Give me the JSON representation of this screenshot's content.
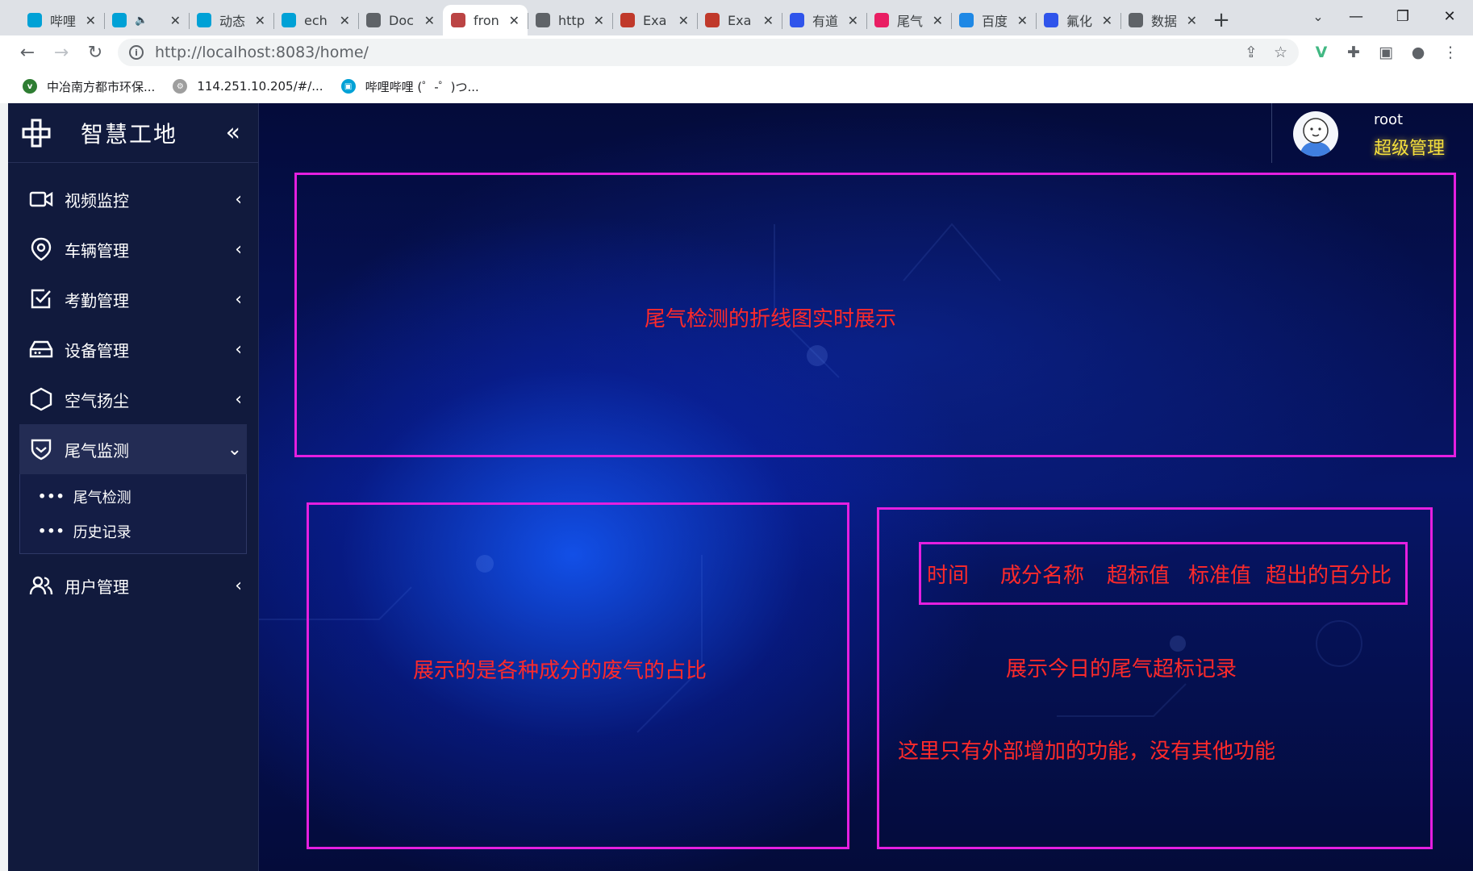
{
  "browser": {
    "tabs": [
      {
        "title": "哔哩",
        "favicon_color": "#00a1d6",
        "favicon": "tv-icon"
      },
      {
        "title": "",
        "favicon_color": "#00a1d6",
        "favicon": "tv-icon",
        "audio": "🔈"
      },
      {
        "title": "动态",
        "favicon_color": "#00a1d6",
        "favicon": "tv-icon"
      },
      {
        "title": "ech",
        "favicon_color": "#00a1d6",
        "favicon": "tv-icon"
      },
      {
        "title": "Doc",
        "favicon_color": "#5f6368",
        "favicon": "globe-icon"
      },
      {
        "title": "fron",
        "favicon_color": "#b44",
        "favicon": "app-icon",
        "active": true
      },
      {
        "title": "http",
        "favicon_color": "#5f6368",
        "favicon": "globe-icon"
      },
      {
        "title": "Exa",
        "favicon_color": "#c0392b",
        "favicon": "q-icon"
      },
      {
        "title": "Exa",
        "favicon_color": "#c0392b",
        "favicon": "q-icon"
      },
      {
        "title": "有道",
        "favicon_color": "#2f54eb",
        "favicon": "paw-icon"
      },
      {
        "title": "尾气",
        "favicon_color": "#e91e63",
        "favicon": "y-icon"
      },
      {
        "title": "百度",
        "favicon_color": "#1e88e5",
        "favicon": "translate-icon"
      },
      {
        "title": "氟化",
        "favicon_color": "#2f54eb",
        "favicon": "paw-icon"
      },
      {
        "title": "数据",
        "favicon_color": "#5f6368",
        "favicon": "globe-icon"
      }
    ],
    "url": "http://localhost:8083/home/",
    "bookmarks": [
      {
        "label": "中冶南方都市环保...",
        "color": "#2e7d32",
        "letter": "v"
      },
      {
        "label": "114.251.10.205/#/...",
        "color": "#9e9e9e",
        "letter": "⚙"
      },
      {
        "label": "哔哩哔哩 (゜-゜)つ...",
        "color": "#00a1d6",
        "letter": "▣"
      }
    ]
  },
  "sidebar": {
    "title": "智慧工地",
    "collapse_glyph": "«",
    "items": [
      {
        "label": "视频监控",
        "icon": "video-camera-icon"
      },
      {
        "label": "车辆管理",
        "icon": "location-pin-icon"
      },
      {
        "label": "考勤管理",
        "icon": "checkbox-icon"
      },
      {
        "label": "设备管理",
        "icon": "device-icon"
      },
      {
        "label": "空气扬尘",
        "icon": "hexagon-icon"
      },
      {
        "label": "尾气监测",
        "icon": "shield-check-icon",
        "open": true
      },
      {
        "label": "用户管理",
        "icon": "users-icon"
      }
    ],
    "sub_items": [
      {
        "label": "尾气检测"
      },
      {
        "label": "历史记录"
      }
    ]
  },
  "user": {
    "name": "root",
    "role": "超级管理"
  },
  "panels": {
    "top_note": "尾气检测的折线图实时展示",
    "left_note": "展示的是各种成分的废气的占比",
    "right_headers": [
      "时间",
      "成分名称",
      "超标值",
      "标准值",
      "超出的百分比"
    ],
    "right_note1": "展示今日的尾气超标记录",
    "right_note2": "这里只有外部增加的功能，没有其他功能"
  },
  "colors": {
    "sidebar_bg": "#111a3d",
    "box_border": "#e51fe0",
    "note_text": "#ff2a2a",
    "role_text": "#f5e03c"
  }
}
